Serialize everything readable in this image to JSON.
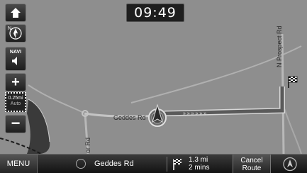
{
  "clock": "09:49",
  "map": {
    "road_labels": {
      "geddes": "Geddes Rd",
      "north_prospect": "N Prospect Rd",
      "side_road": "or Rd"
    }
  },
  "controls": {
    "compass_label": "N",
    "navi_label": "NAVI",
    "zoom_in": "+",
    "zoom_out": "−",
    "scale_value": "0.25mi",
    "scale_mode": "Auto"
  },
  "bottom_bar": {
    "menu_label": "MENU",
    "current_street": "Geddes Rd",
    "distance": "1.3 mi",
    "time": "2 mins",
    "cancel_route_line1": "Cancel",
    "cancel_route_line2": "Route"
  },
  "colors": {
    "map_background": "#8e8e8e",
    "road": "#b8b8b8",
    "route": "#5a5a5a",
    "water": "#3a3a3a"
  },
  "icons": [
    "home-icon",
    "compass-icon",
    "speaker-icon",
    "destination-flag-icon",
    "vehicle-position-icon",
    "street-icon",
    "gps-icon"
  ]
}
